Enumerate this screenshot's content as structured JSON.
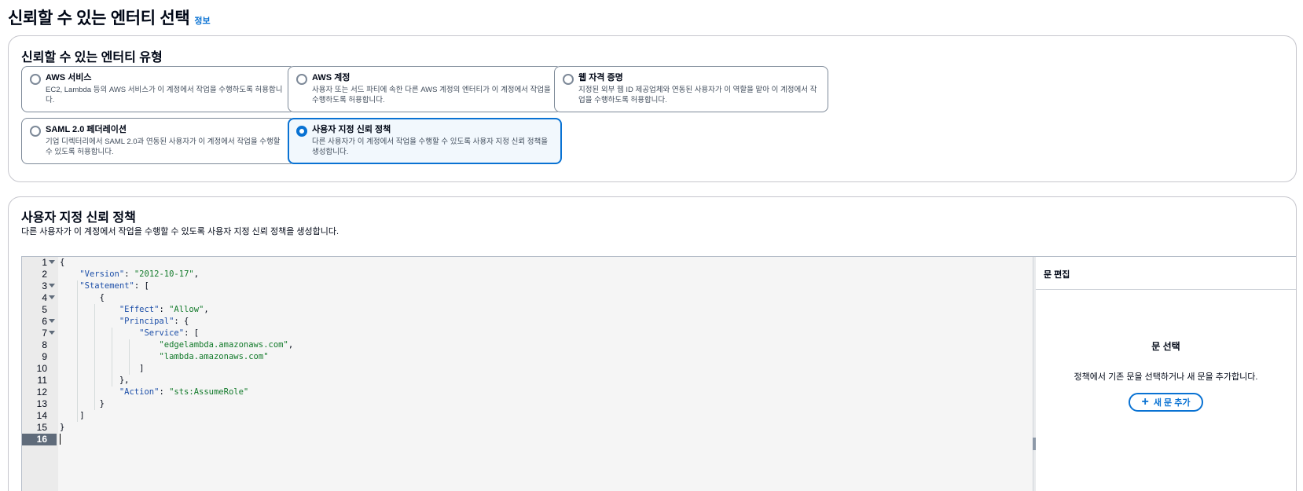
{
  "header": {
    "title": "신뢰할 수 있는 엔터티 선택",
    "info": "정보"
  },
  "entity_types": {
    "title": "신뢰할 수 있는 엔터티 유형",
    "options": [
      {
        "label": "AWS 서비스",
        "desc": "EC2, Lambda 등의 AWS 서비스가 이 계정에서 작업을 수행하도록 허용합니다.",
        "selected": false
      },
      {
        "label": "AWS 계정",
        "desc": "사용자 또는 서드 파티에 속한 다른 AWS 계정의 엔터티가 이 계정에서 작업을 수행하도록 허용합니다.",
        "selected": false
      },
      {
        "label": "웹 자격 증명",
        "desc": "지정된 외부 웹 ID 제공업체와 연동된 사용자가 이 역할을 맡아 이 계정에서 작업을 수행하도록 허용합니다.",
        "selected": false
      },
      {
        "label": "SAML 2.0 페더레이션",
        "desc": "기업 디렉터리에서 SAML 2.0과 연동된 사용자가 이 계정에서 작업을 수행할 수 있도록 허용합니다.",
        "selected": false
      },
      {
        "label": "사용자 지정 신뢰 정책",
        "desc": "다른 사용자가 이 계정에서 작업을 수행할 수 있도록 사용자 지정 신뢰 정책을 생성합니다.",
        "selected": true
      }
    ]
  },
  "policy": {
    "title": "사용자 지정 신뢰 정책",
    "desc": "다른 사용자가 이 계정에서 작업을 수행할 수 있도록 사용자 지정 신뢰 정책을 생성합니다.",
    "line_numbers": [
      "1",
      "2",
      "3",
      "4",
      "5",
      "6",
      "7",
      "8",
      "9",
      "10",
      "11",
      "12",
      "13",
      "14",
      "15",
      "16"
    ],
    "active_line": "16"
  },
  "side_panel": {
    "header": "문 편집",
    "title": "문 선택",
    "desc": "정책에서 기존 문을 선택하거나 새 문을 추가합니다.",
    "add_label": "새 문 추가",
    "add_icon": "plus-icon"
  },
  "colors": {
    "accent": "#0972d3",
    "key": "#1c4ea8",
    "string": "#127a2a"
  }
}
